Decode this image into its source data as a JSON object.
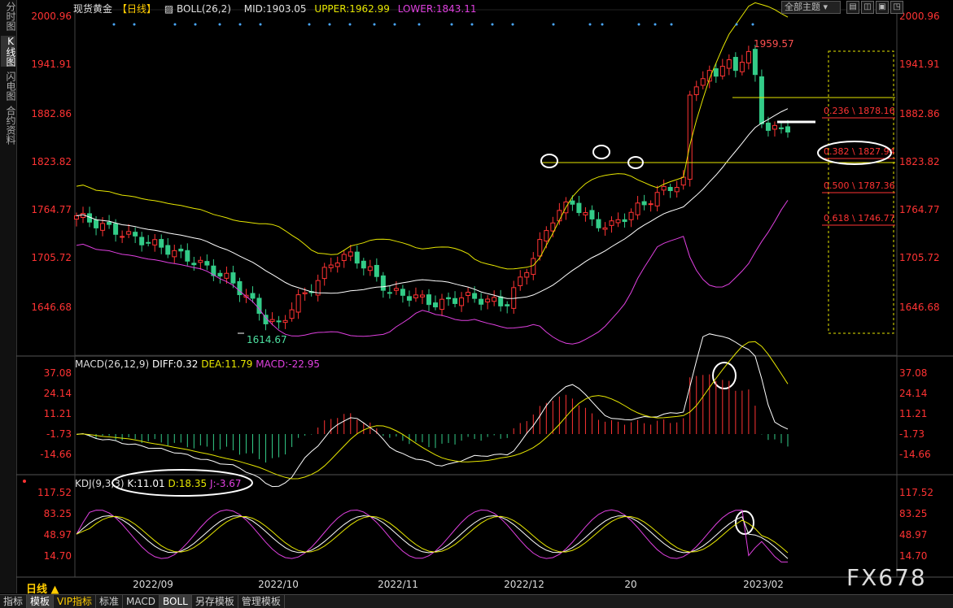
{
  "header": {
    "title": "现货黄金",
    "period": "【日线】",
    "boll": "BOLL(26,2)",
    "mid": "MID:1903.05",
    "upper": "UPPER:1962.99",
    "lower": "LOWER:1843.11",
    "theme": "全部主题",
    "win_buttons": [
      "▤",
      "◫",
      "▣",
      "◳"
    ]
  },
  "left_tabs": [
    "分时图",
    "K线图",
    "闪电图",
    "合约资料"
  ],
  "price_axis": {
    "left": [
      "2000.96",
      "1941.91",
      "1882.86",
      "1823.82",
      "1764.77",
      "1705.72",
      "1646.68"
    ],
    "right": [
      "2000.96",
      "1941.91",
      "1882.86",
      "1823.82",
      "1764.77",
      "1705.72",
      "1646.68"
    ]
  },
  "price_annotations": {
    "high": "1959.57",
    "low": "1614.67",
    "fib": [
      "0.236 \\ 1878.16",
      "0.382 \\ 1827.94",
      "0.500 \\ 1787.36",
      "0.618 \\ 1746.77"
    ]
  },
  "macd": {
    "label": "MACD(26,12,9)",
    "diff": "DIFF:0.32",
    "dea": "DEA:11.79",
    "macd": "MACD:-22.95",
    "axis": [
      "37.08",
      "24.14",
      "11.21",
      "-1.73",
      "-14.66"
    ]
  },
  "kdj": {
    "label": "KDJ(9,3,3)",
    "k": "K:11.01",
    "d": "D:18.35",
    "j": "J:-3.67",
    "axis": [
      "117.52",
      "83.25",
      "48.97",
      "14.70"
    ]
  },
  "dates": [
    "2022/09",
    "2022/10",
    "2022/11",
    "2022/12",
    "20",
    "2023/02"
  ],
  "period_badge": "日线 ▲",
  "bottom_tabs": [
    "指标",
    "模板",
    "VIP指标",
    "标准",
    "MACD",
    "BOLL",
    "另存模板",
    "管理模板"
  ],
  "watermark": "FX678",
  "colors": {
    "up": "#ff3333",
    "down": "#33cc88",
    "mid": "#ffffff",
    "upper": "#e6e600",
    "lower": "#e040e0",
    "axis": "#ff3333"
  }
}
